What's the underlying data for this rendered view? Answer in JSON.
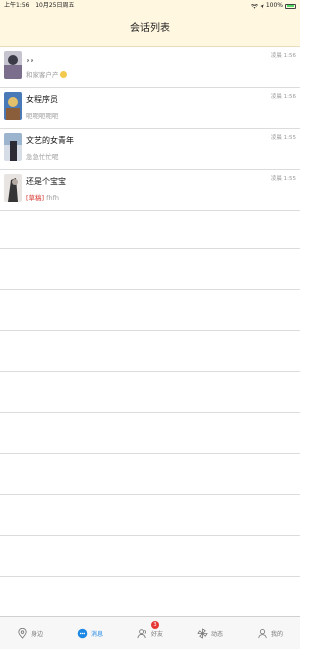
{
  "status_bar": {
    "time": "上午1:56",
    "date": "10月25日周五",
    "battery_text": "100%"
  },
  "navbar": {
    "title": "会话列表"
  },
  "conversations": [
    {
      "name": "，，",
      "preview": "和家客户产",
      "time": "凌晨 1:56",
      "preview_has_emoji": true,
      "avatar_colors": [
        "#c5c4cf",
        "#3a3b46",
        "#7a6e8c"
      ]
    },
    {
      "name": "女程序员",
      "preview": "呃呃呃呃呃",
      "time": "凌晨 1:56",
      "avatar_colors": [
        "#4a79b8",
        "#e3c06a",
        "#8a5d3b"
      ]
    },
    {
      "name": "文艺的女青年",
      "preview": "急急忙忙呢",
      "time": "凌晨 1:55",
      "avatar_colors": [
        "#9db4cf",
        "#2c2b35",
        "#d7dde6"
      ]
    },
    {
      "name": "还是个宝宝",
      "preview_draft_tag": "[草稿]",
      "preview": "fhfh",
      "time": "凌晨 1:55",
      "avatar_colors": [
        "#e8e4e1",
        "#353535",
        "#b4aaa2"
      ]
    }
  ],
  "tabbar": {
    "tabs": [
      {
        "label": "身边",
        "icon": "location-pin-icon"
      },
      {
        "label": "消息",
        "icon": "chat-bubble-icon",
        "active": true
      },
      {
        "label": "好友",
        "icon": "friends-icon",
        "badge": "3"
      },
      {
        "label": "动态",
        "icon": "pinwheel-icon"
      },
      {
        "label": "我的",
        "icon": "person-icon"
      }
    ]
  },
  "colors": {
    "accent": "#1e88e5",
    "header_bg": "#fff7e0",
    "badge": "#e53935"
  }
}
